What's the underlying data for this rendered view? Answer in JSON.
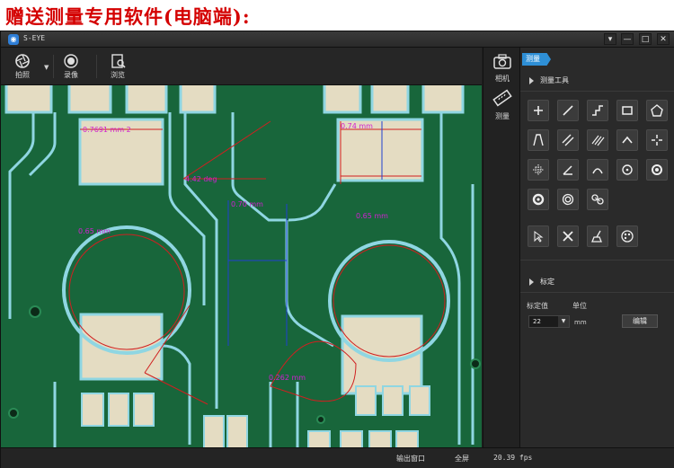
{
  "banner": {
    "text": "赠送测量专用软件(电脑端):"
  },
  "titlebar": {
    "app_name": "S-EYE",
    "logo": "camera-app-logo"
  },
  "window_controls": {
    "menu": "▾",
    "minimize": "—",
    "maximize": "□",
    "close": "✕"
  },
  "toolbar": {
    "photo_label": "拍照",
    "record_label": "录像",
    "browse_label": "浏览"
  },
  "side_tabs": {
    "camera_label": "相机",
    "measure_label": "测量"
  },
  "panel": {
    "tag": "测量",
    "tools_title": "测量工具",
    "calibration_title": "标定",
    "calib_value_label": "标定值",
    "unit_label": "单位",
    "calib_value": "22",
    "unit": "mm",
    "edit_button": "编辑",
    "tool_icons": [
      "point-icon",
      "line-icon",
      "polyline-icon",
      "rectangle-icon",
      "polygon-icon",
      "angle-lines-icon",
      "parallel-lines-icon",
      "multi-lines-icon",
      "angle-icon",
      "crosshair-icon",
      "grid-icon",
      "corner-angle-icon",
      "arc-icon",
      "circle-center-icon",
      "circle-icon",
      "ring-icon",
      "concentric-circle-icon",
      "two-circles-icon",
      "select-icon",
      "delete-icon",
      "clear-icon",
      "color-palette-icon"
    ]
  },
  "measurements": {
    "m1": "0.7691 mm 2",
    "m2": "0.74 mm",
    "m3": "4.42 deg",
    "m4": "0.70 mm",
    "m5": "0.65 mm",
    "m6": "0.65 mm",
    "m7": "0.262 mm"
  },
  "status": {
    "output_window": "输出窗口",
    "fullscreen": "全屏",
    "fps": "20.39 fps"
  },
  "colors": {
    "accent": "#2e8fd6",
    "pcb_green": "#1a6b3f",
    "trace": "#7fd8e6",
    "pad": "#e6dcc0",
    "measure": "#d020d0",
    "banner_red": "#d40000"
  }
}
